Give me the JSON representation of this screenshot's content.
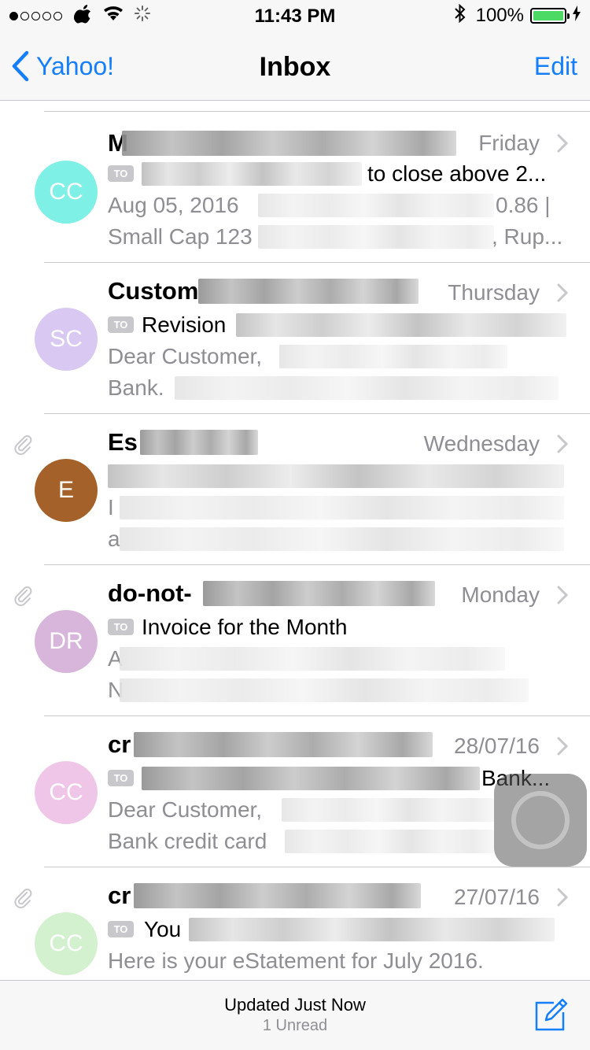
{
  "status_bar": {
    "time": "11:43 PM",
    "battery": "100%",
    "icons": [
      "signal-dots-icon",
      "apple-icon",
      "wifi-icon",
      "loading-spinner-icon",
      "bluetooth-icon",
      "battery-icon",
      "charging-bolt-icon"
    ]
  },
  "nav": {
    "back_label": "Yahoo!",
    "title": "Inbox",
    "edit_label": "Edit"
  },
  "badge_label": "TO",
  "colors": {
    "accent": "#147efb",
    "avatars": [
      "#7ef0e6",
      "#d9c8f2",
      "#a4622a",
      "#d8b6db",
      "#efc6e8",
      "#d3f0cf"
    ]
  },
  "messages": [
    {
      "avatar": "CC",
      "sender": "M",
      "date": "Friday",
      "subject": "to close above 2...",
      "preview_line1": "Aug 05, 2016",
      "preview_line1_end": "0.86 |",
      "preview_line2": "Small Cap 123",
      "preview_line2_end": ", Rup...",
      "attachment": false
    },
    {
      "avatar": "SC",
      "sender": "Custom",
      "date": "Thursday",
      "subject": "Revision",
      "preview_line1": "Dear Customer,",
      "preview_line2": "Bank.",
      "attachment": false
    },
    {
      "avatar": "E",
      "sender": "Es",
      "date": "Wednesday",
      "subject": "",
      "preview_line1": "I",
      "preview_line2": "a",
      "attachment": true
    },
    {
      "avatar": "DR",
      "sender": "do-not-",
      "date": "Monday",
      "subject": "Invoice for the Month",
      "preview_line1": "A",
      "preview_line2": "N",
      "attachment": true
    },
    {
      "avatar": "CC",
      "sender": "cr",
      "date": "28/07/16",
      "subject": "Bank...",
      "preview_line1": "Dear Customer,",
      "preview_line2": "Bank credit card",
      "attachment": false
    },
    {
      "avatar": "CC",
      "sender": "cr",
      "date": "27/07/16",
      "subject": "You",
      "preview_line1": "Here is your eStatement for July 2016.",
      "preview_line2": "",
      "attachment": true
    }
  ],
  "toolbar": {
    "status": "Updated Just Now",
    "unread": "1 Unread"
  }
}
